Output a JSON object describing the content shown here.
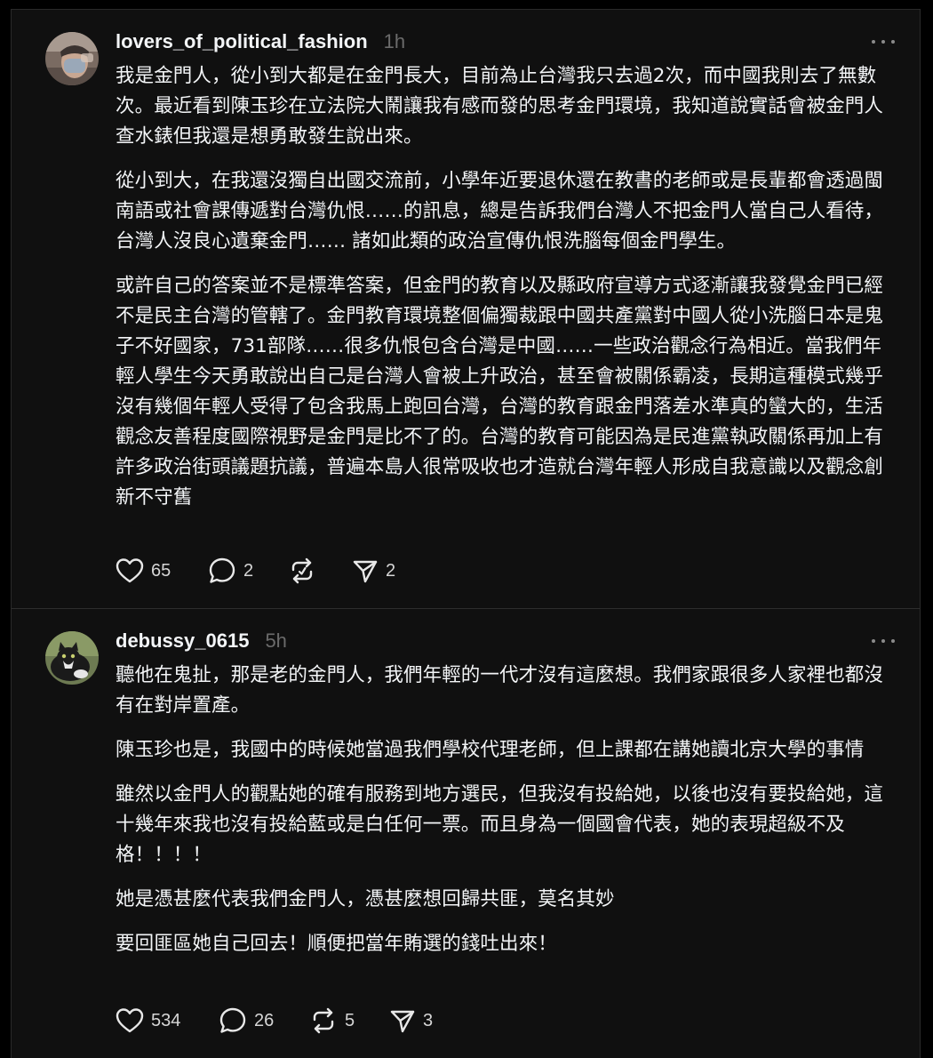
{
  "posts": [
    {
      "username": "lovers_of_political_fashion",
      "time": "1h",
      "avatar_icon": "user-avatar-photo",
      "paragraphs": [
        "我是金門人，從小到大都是在金門長大，目前為止台灣我只去過2次，而中國我則去了無數次。最近看到陳玉珍在立法院大鬧讓我有感而發的思考金門環境，我知道說實話會被金門人查水錶但我還是想勇敢發生說出來。",
        "從小到大，在我還沒獨自出國交流前，小學年近要退休還在教書的老師或是長輩都會透過閩南語或社會課傳遞對台灣仇恨……的訊息，總是告訴我們台灣人不把金門人當自己人看待，台灣人沒良心遺棄金門…… 諸如此類的政治宣傳仇恨洗腦每個金門學生。",
        "或許自己的答案並不是標準答案，但金門的教育以及縣政府宣導方式逐漸讓我發覺金門已經不是民主台灣的管轄了。金門教育環境整個偏獨裁跟中國共產黨對中國人從小洗腦日本是鬼子不好國家，731部隊……很多仇恨包含台灣是中國……一些政治觀念行為相近。當我們年輕人學生今天勇敢說出自己是台灣人會被上升政治，甚至會被關係霸凌，長期這種模式幾乎沒有幾個年輕人受得了包含我馬上跑回台灣，台灣的教育跟金門落差水準真的蠻大的，生活觀念友善程度國際視野是金門是比不了的。台灣的教育可能因為是民進黨執政關係再加上有許多政治街頭議題抗議，普遍本島人很常吸收也才造就台灣年輕人形成自我意識以及觀念創新不守舊"
      ],
      "likes": "65",
      "replies": "2",
      "reposts": "",
      "shares": "2"
    },
    {
      "username": "debussy_0615",
      "time": "5h",
      "avatar_icon": "cat-avatar-photo",
      "paragraphs": [
        "聽他在鬼扯，那是老的金門人，我們年輕的一代才沒有這麼想。我們家跟很多人家裡也都沒有在對岸置產。",
        "陳玉珍也是，我國中的時候她當過我們學校代理老師，但上課都在講她讀北京大學的事情",
        "雖然以金門人的觀點她的確有服務到地方選民，但我沒有投給她，以後也沒有要投給她，這十幾年來我也沒有投給藍或是白任何一票。而且身為一個國會代表，她的表現超級不及格！！！！",
        "她是憑甚麼代表我們金門人，憑甚麼想回歸共匪，莫名其妙",
        "要回匪區她自己回去！順便把當年賄選的錢吐出來！"
      ],
      "likes": "534",
      "replies": "26",
      "reposts": "5",
      "shares": "3"
    }
  ],
  "icons": {
    "like": "heart-icon",
    "reply": "comment-icon",
    "repost": "repost-icon",
    "share": "send-icon",
    "more": "more-dots-icon"
  },
  "colors": {
    "background": "#000000",
    "panel": "#101010",
    "text": "#f3f5f7",
    "muted": "#6b6b6b"
  }
}
